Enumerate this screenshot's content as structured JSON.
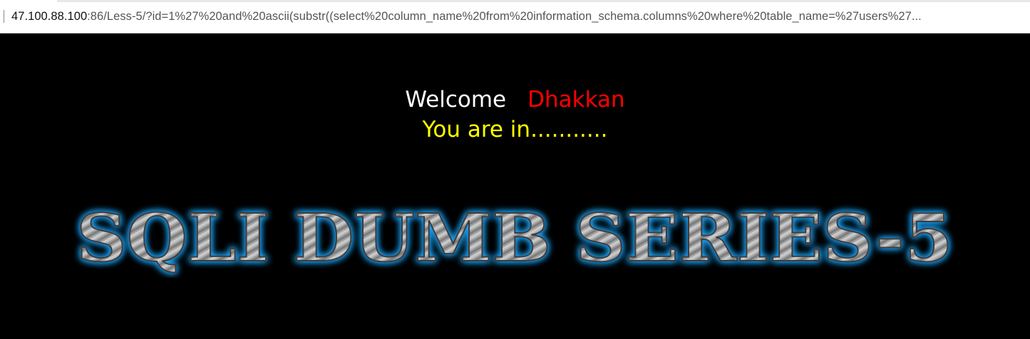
{
  "browser": {
    "url_host": "47.100.88.100",
    "url_rest": ":86/Less-5/?id=1%27%20and%20ascii(substr((select%20column_name%20from%20information_schema.columns%20where%20table_name=%27users%27..."
  },
  "page": {
    "welcome_label": "Welcome",
    "user_name": "Dhakkan",
    "status_message": "You are in...........",
    "banner_title": "SQLI DUMB SERIES-5"
  },
  "colors": {
    "background": "#000000",
    "welcome": "#ffffff",
    "user_name": "#ff0000",
    "status": "#ffff00",
    "banner_glow": "#1fa8ff",
    "banner_metal": "#9a9a9a"
  }
}
